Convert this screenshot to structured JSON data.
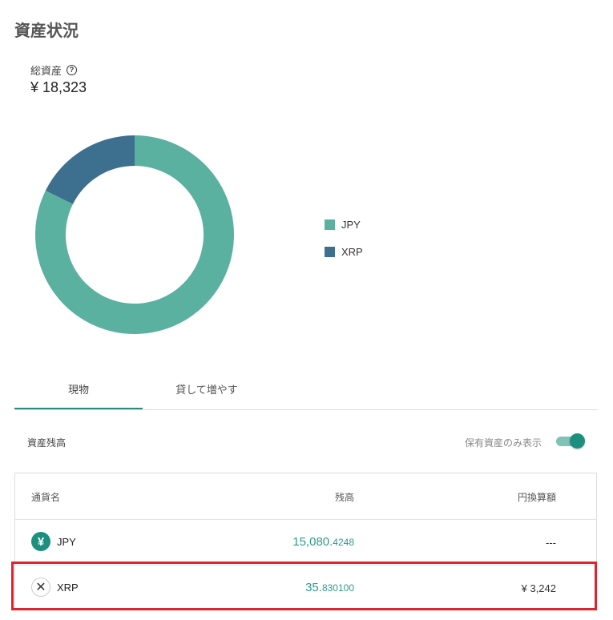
{
  "page": {
    "title": "資産状況"
  },
  "total": {
    "label": "総資産",
    "help_icon": "?",
    "value": "¥ 18,323"
  },
  "chart_data": {
    "type": "pie",
    "categories": [
      "JPY",
      "XRP"
    ],
    "values": [
      15080.4248,
      3242
    ],
    "colors": [
      "#5bb1a0",
      "#3d6f8e"
    ],
    "legend_position": "right"
  },
  "legend": {
    "items": [
      {
        "label": "JPY",
        "color": "#5bb1a0"
      },
      {
        "label": "XRP",
        "color": "#3d6f8e"
      }
    ]
  },
  "tabs": [
    {
      "label": "現物"
    },
    {
      "label": "貸して増やす"
    }
  ],
  "section": {
    "label": "資産残高",
    "toggle_label": "保有資産のみ表示"
  },
  "table": {
    "headers": {
      "name": "通貨名",
      "balance": "残高",
      "yen": "円換算額"
    },
    "rows": [
      {
        "icon": "¥",
        "name": "JPY",
        "balance_int": "15,080.",
        "balance_dec": "4248",
        "yen": "---"
      },
      {
        "icon": "✕",
        "name": "XRP",
        "balance_int": "35.",
        "balance_dec": "830100",
        "yen": "¥ 3,242"
      }
    ]
  },
  "colors": {
    "accent": "#1d8f7f",
    "highlight": "#e0222e"
  }
}
